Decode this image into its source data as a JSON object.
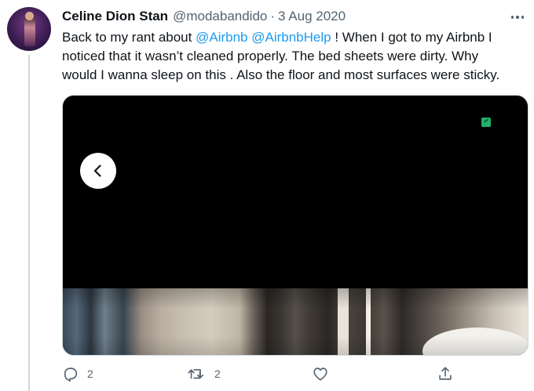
{
  "tweet": {
    "author_name": "Celine Dion Stan",
    "author_handle": "@modabandido",
    "separator": "·",
    "date": "3 Aug 2020",
    "text": {
      "line1_a": "Back to my rant about ",
      "mention1": "@Airbnb",
      "line1_b": " ",
      "mention2": "@AirbnbHelp",
      "line1_c": " ! When I got to my Airbnb I",
      "line2": "noticed that it wasn’t cleaned properly.  The bed sheets were dirty. Why",
      "line3": "would I wanna sleep on this . Also the floor and most surfaces were sticky."
    },
    "media": {
      "badge_color": "#1fb26a",
      "nav_icon": "chevron-left-icon"
    },
    "actions": {
      "reply_count": "2",
      "retweet_count": "2",
      "like_count": "",
      "share_count": ""
    }
  },
  "colors": {
    "link": "#1d9bf0",
    "secondary_text": "#536471",
    "primary_text": "#0f1419"
  }
}
